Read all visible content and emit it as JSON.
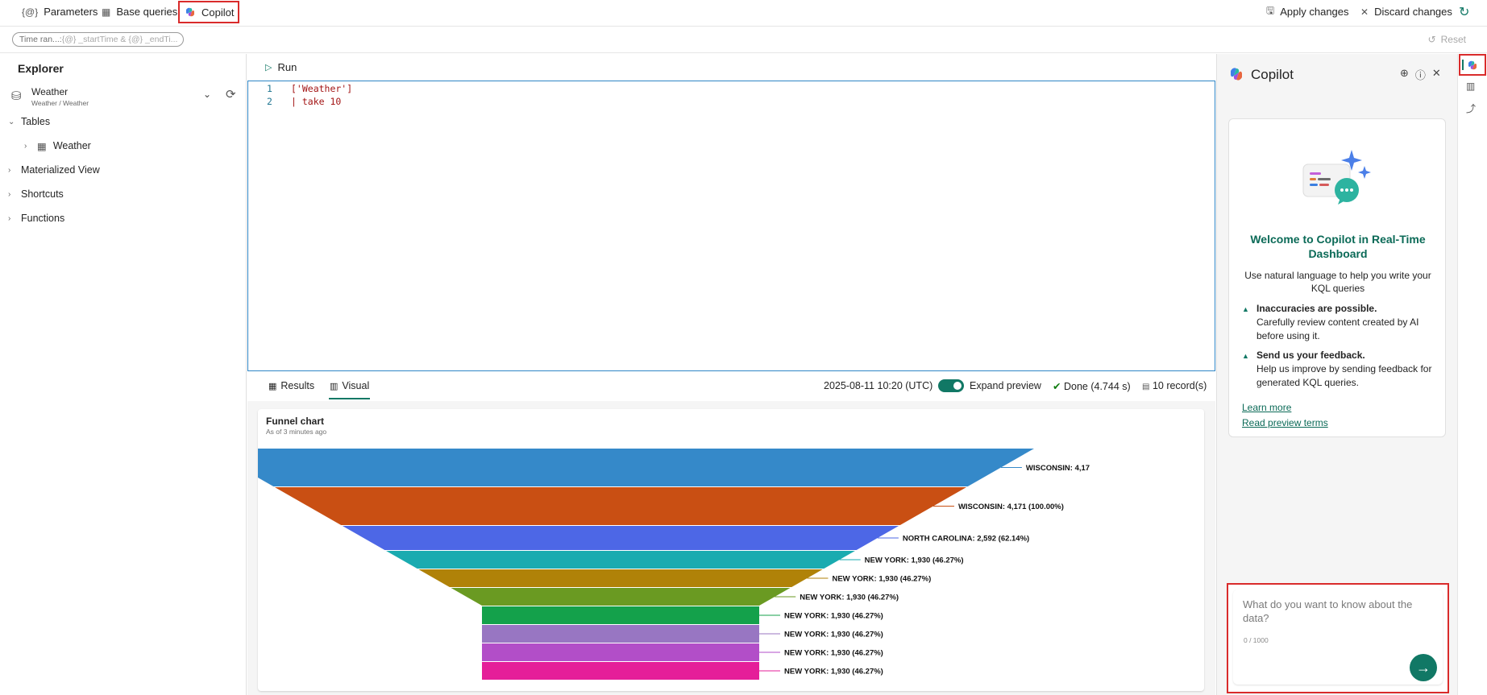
{
  "toolbar": {
    "parameters_label": "Parameters",
    "base_queries_label": "Base queries",
    "copilot_label": "Copilot",
    "apply_label": "Apply changes",
    "discard_label": "Discard changes"
  },
  "time_range": {
    "label": "Time ran...: ",
    "value": "{@} _startTime  & {@} _endTi..."
  },
  "reset_label": "Reset",
  "explorer": {
    "title": "Explorer",
    "database": {
      "name": "Weather",
      "path": "Weather / Weather"
    },
    "tree": [
      {
        "label": "Tables",
        "expanded": true
      },
      {
        "label": "Weather",
        "child": true
      },
      {
        "label": "Materialized View"
      },
      {
        "label": "Shortcuts"
      },
      {
        "label": "Functions"
      }
    ]
  },
  "editor": {
    "run_label": "Run",
    "lines": [
      {
        "num": "1",
        "text": "['Weather']"
      },
      {
        "num": "2",
        "text": "| take 10"
      }
    ]
  },
  "results": {
    "tab_results": "Results",
    "tab_visual": "Visual",
    "timestamp": "2025-08-11 10:20 (UTC)",
    "expand_preview": "Expand preview",
    "status": "Done (4.744 s)",
    "records": "10 record(s)"
  },
  "chart": {
    "title": "Funnel chart",
    "subtitle": "As of 3 minutes ago"
  },
  "chart_data": {
    "type": "funnel",
    "title": "Funnel chart",
    "categories": [
      "WISCONSIN",
      "WISCONSIN",
      "NORTH CAROLINA",
      "NEW YORK",
      "NEW YORK",
      "NEW YORK",
      "NEW YORK",
      "NEW YORK",
      "NEW YORK",
      "NEW YORK"
    ],
    "values": [
      4171,
      4171,
      2592,
      1930,
      1930,
      1930,
      1930,
      1930,
      1930,
      1930
    ],
    "labels": [
      "WISCONSIN: 4,17",
      "WISCONSIN: 4,171 (100.00%)",
      "NORTH CAROLINA: 2,592 (62.14%)",
      "NEW YORK: 1,930 (46.27%)",
      "NEW YORK: 1,930 (46.27%)",
      "NEW YORK: 1,930 (46.27%)",
      "NEW YORK: 1,930 (46.27%)",
      "NEW YORK: 1,930 (46.27%)",
      "NEW YORK: 1,930 (46.27%)",
      "NEW YORK: 1,930 (46.27%)"
    ],
    "colors": [
      "#3589c9",
      "#c94f13",
      "#4d67e6",
      "#1aabb0",
      "#b08208",
      "#6a9a22",
      "#14a14b",
      "#9876c2",
      "#b24ec8",
      "#e51e99"
    ]
  },
  "copilot": {
    "title": "Copilot",
    "welcome_title": "Welcome to Copilot in Real-Time Dashboard",
    "welcome_desc": "Use natural language to help you write your KQL queries",
    "inaccuracies_title": "Inaccuracies are possible.",
    "inaccuracies_text": "Carefully review content created by AI before using it.",
    "feedback_title": "Send us your feedback.",
    "feedback_text": "Help us improve by sending feedback for generated KQL queries.",
    "learn_more": "Learn more",
    "preview_terms": "Read preview terms",
    "input_placeholder": "What do you want to know about the data?",
    "counter": "0 / 1000"
  }
}
